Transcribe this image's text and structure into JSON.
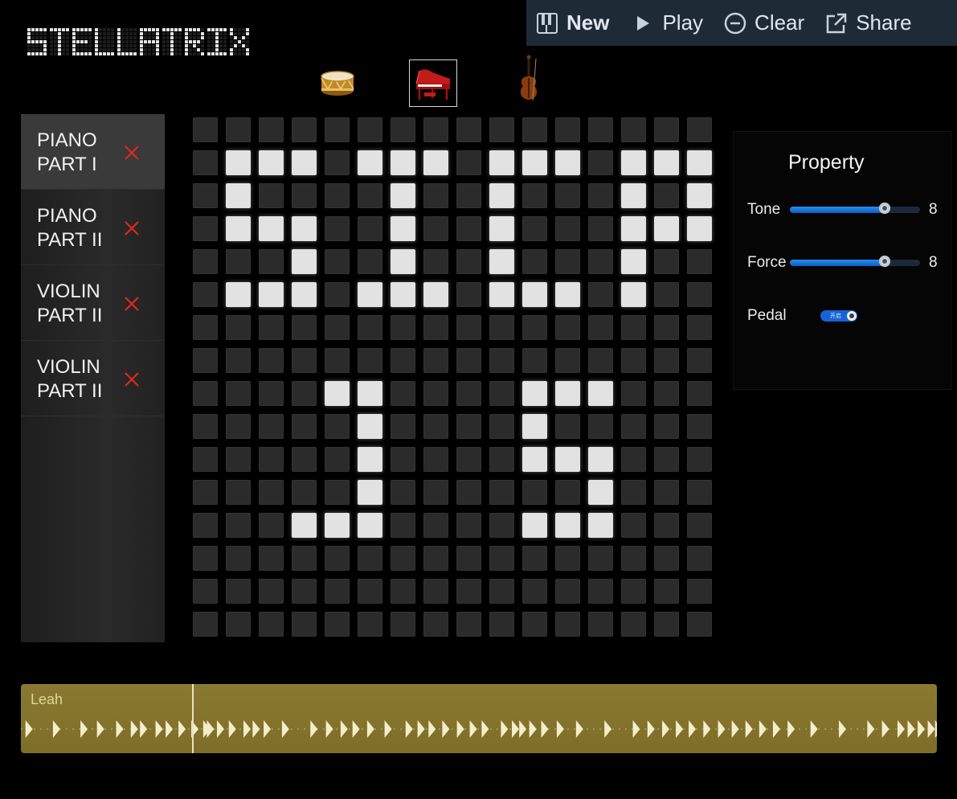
{
  "app": {
    "logo_text": "STELLATRIX"
  },
  "toolbar": {
    "new_label": "New",
    "play_label": "Play",
    "clear_label": "Clear",
    "share_label": "Share",
    "icons": {
      "new": "piano-keys-icon",
      "play": "play-icon",
      "clear": "minus-circle-icon",
      "share": "share-icon"
    }
  },
  "instruments": [
    {
      "name": "drum",
      "icon": "drum-icon",
      "selected": false
    },
    {
      "name": "piano",
      "icon": "grand-piano-icon",
      "selected": true
    },
    {
      "name": "violin",
      "icon": "violin-icon",
      "selected": false
    }
  ],
  "tracks": [
    {
      "label": "PIANO\nPART  I",
      "active": true
    },
    {
      "label": "PIANO\nPART II",
      "active": false
    },
    {
      "label": "VIOLIN\nPART II",
      "active": false
    },
    {
      "label": "VIOLIN\nPART II",
      "active": false
    }
  ],
  "grid": {
    "rows": 16,
    "cols": 16,
    "active_cells": [
      [
        1,
        1
      ],
      [
        1,
        2
      ],
      [
        1,
        3
      ],
      [
        1,
        5
      ],
      [
        1,
        6
      ],
      [
        1,
        7
      ],
      [
        1,
        9
      ],
      [
        1,
        10
      ],
      [
        1,
        11
      ],
      [
        1,
        13
      ],
      [
        1,
        14
      ],
      [
        1,
        15
      ],
      [
        2,
        1
      ],
      [
        2,
        6
      ],
      [
        2,
        9
      ],
      [
        2,
        13
      ],
      [
        2,
        15
      ],
      [
        3,
        1
      ],
      [
        3,
        2
      ],
      [
        3,
        3
      ],
      [
        3,
        6
      ],
      [
        3,
        9
      ],
      [
        3,
        13
      ],
      [
        3,
        14
      ],
      [
        3,
        15
      ],
      [
        4,
        3
      ],
      [
        4,
        6
      ],
      [
        4,
        9
      ],
      [
        4,
        13
      ],
      [
        5,
        1
      ],
      [
        5,
        2
      ],
      [
        5,
        3
      ],
      [
        5,
        5
      ],
      [
        5,
        6
      ],
      [
        5,
        7
      ],
      [
        5,
        9
      ],
      [
        5,
        10
      ],
      [
        5,
        11
      ],
      [
        5,
        13
      ],
      [
        8,
        4
      ],
      [
        8,
        5
      ],
      [
        8,
        10
      ],
      [
        8,
        11
      ],
      [
        8,
        12
      ],
      [
        9,
        5
      ],
      [
        9,
        10
      ],
      [
        10,
        5
      ],
      [
        10,
        10
      ],
      [
        10,
        11
      ],
      [
        10,
        12
      ],
      [
        11,
        5
      ],
      [
        11,
        12
      ],
      [
        12,
        3
      ],
      [
        12,
        4
      ],
      [
        12,
        5
      ],
      [
        12,
        10
      ],
      [
        12,
        11
      ],
      [
        12,
        12
      ]
    ]
  },
  "property": {
    "title": "Property",
    "tone": {
      "label": "Tone",
      "value": "8",
      "fraction": 0.73
    },
    "force": {
      "label": "Force",
      "value": "8",
      "fraction": 0.73
    },
    "pedal": {
      "label": "Pedal",
      "toggle_text": "开启",
      "on": true
    }
  },
  "timeline": {
    "label": "Leah",
    "playhead_fraction": 0.187,
    "note_positions": [
      0.005,
      0.035,
      0.065,
      0.083,
      0.104,
      0.12,
      0.13,
      0.147,
      0.158,
      0.172,
      0.186,
      0.199,
      0.203,
      0.214,
      0.227,
      0.243,
      0.253,
      0.265,
      0.285,
      0.316,
      0.333,
      0.349,
      0.362,
      0.378,
      0.397,
      0.42,
      0.433,
      0.445,
      0.46,
      0.476,
      0.49,
      0.503,
      0.524,
      0.536,
      0.544,
      0.555,
      0.568,
      0.585,
      0.606,
      0.637,
      0.668,
      0.684,
      0.7,
      0.715,
      0.729,
      0.745,
      0.761,
      0.776,
      0.791,
      0.806,
      0.821,
      0.837,
      0.862,
      0.893,
      0.924,
      0.94,
      0.957,
      0.968,
      0.979,
      0.99,
      0.998
    ]
  },
  "colors": {
    "toolbar_bg": "#1e2a36",
    "cell_off": "#2b2b2b",
    "cell_on": "#e2e2e2",
    "close_red": "#e0281e",
    "slider_blue": "#1a7ae8",
    "timeline_gold": "#857530"
  }
}
